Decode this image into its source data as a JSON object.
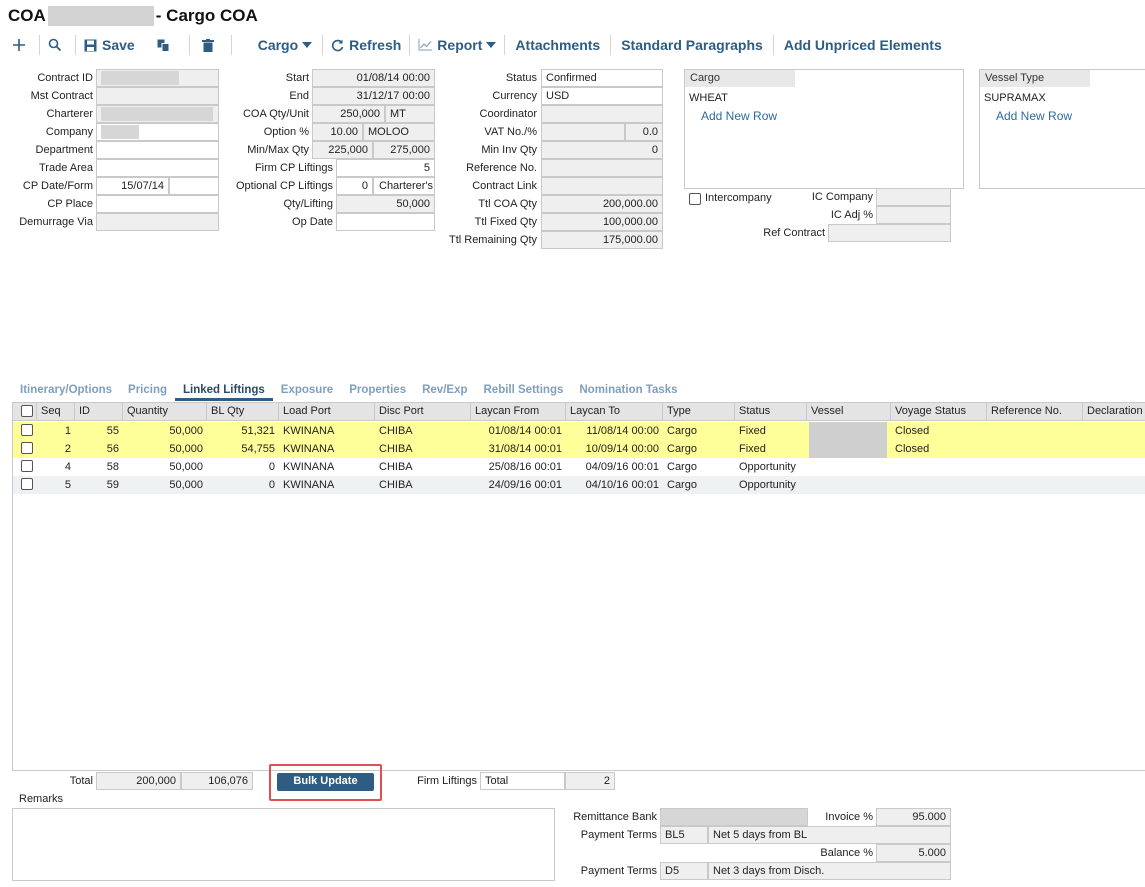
{
  "header": {
    "title_prefix": "COA",
    "title_suffix": "- Cargo COA"
  },
  "toolbar": {
    "save": "Save",
    "cargo": "Cargo",
    "refresh": "Refresh",
    "report": "Report",
    "attachments": "Attachments",
    "standard_paragraphs": "Standard Paragraphs",
    "add_unpriced": "Add Unpriced Elements"
  },
  "col1": {
    "contract_id": "Contract ID",
    "mst_contract": "Mst Contract",
    "charterer": "Charterer",
    "company": "Company",
    "department": "Department",
    "trade_area": "Trade Area",
    "cp_date_form": "CP Date/Form",
    "cp_date_value": "15/07/14",
    "cp_place": "CP Place",
    "demurrage_via": "Demurrage Via"
  },
  "col2": {
    "start": "Start",
    "start_value": "01/08/14 00:00",
    "end": "End",
    "end_value": "31/12/17 00:00",
    "coa_qty_unit": "COA Qty/Unit",
    "coa_qty_value": "250,000",
    "coa_unit_value": "MT",
    "option_pct": "Option %",
    "option_value": "10.00",
    "option_type": "MOLOO",
    "min_max_qty": "Min/Max Qty",
    "min_value": "225,000",
    "max_value": "275,000",
    "firm_cp_liftings": "Firm CP Liftings",
    "firm_cp_value": "5",
    "optional_cp_liftings": "Optional CP Liftings",
    "optional_cp_value": "0",
    "optional_cp_option": "Charterer's",
    "qty_lifting": "Qty/Lifting",
    "qty_lifting_value": "50,000",
    "op_date": "Op Date"
  },
  "col3": {
    "status": "Status",
    "status_value": "Confirmed",
    "currency": "Currency",
    "currency_value": "USD",
    "coordinator": "Coordinator",
    "vat": "VAT No./%",
    "vat_value": "0.0",
    "min_inv_qty": "Min Inv Qty",
    "min_inv_value": "0",
    "reference_no": "Reference No.",
    "contract_link": "Contract Link",
    "ttl_coa_qty": "Ttl COA Qty",
    "ttl_coa_value": "200,000.00",
    "ttl_fixed_qty": "Ttl Fixed Qty",
    "ttl_fixed_value": "100,000.00",
    "ttl_remaining_qty": "Ttl Remaining Qty",
    "ttl_remaining_value": "175,000.00"
  },
  "cargo_box": {
    "header": "Cargo",
    "item": "WHEAT",
    "add_row": "Add New Row"
  },
  "vessel_box": {
    "header": "Vessel Type",
    "item": "SUPRAMAX",
    "add_row": "Add New Row"
  },
  "ic": {
    "intercompany": "Intercompany",
    "ic_company": "IC Company",
    "ic_adj": "IC Adj %",
    "ref_contract": "Ref Contract"
  },
  "tabs": [
    "Itinerary/Options",
    "Pricing",
    "Linked Liftings",
    "Exposure",
    "Properties",
    "Rev/Exp",
    "Rebill Settings",
    "Nomination Tasks"
  ],
  "grid": {
    "columns": [
      "Seq",
      "ID",
      "Quantity",
      "BL Qty",
      "Load Port",
      "Disc Port",
      "Laycan From",
      "Laycan To",
      "Type",
      "Status",
      "Vessel",
      "Voyage Status",
      "Reference No.",
      "Declaration"
    ],
    "rows": [
      [
        "1",
        "55",
        "50,000",
        "51,321",
        "KWINANA",
        "CHIBA",
        "01/08/14 00:01",
        "11/08/14 00:00",
        "Cargo",
        "Fixed",
        "",
        "Closed",
        "",
        ""
      ],
      [
        "2",
        "56",
        "50,000",
        "54,755",
        "KWINANA",
        "CHIBA",
        "31/08/14 00:01",
        "10/09/14 00:00",
        "Cargo",
        "Fixed",
        "",
        "Closed",
        "",
        ""
      ],
      [
        "4",
        "58",
        "50,000",
        "0",
        "KWINANA",
        "CHIBA",
        "25/08/16 00:01",
        "04/09/16 00:01",
        "Cargo",
        "Opportunity",
        "",
        "",
        "",
        ""
      ],
      [
        "5",
        "59",
        "50,000",
        "0",
        "KWINANA",
        "CHIBA",
        "24/09/16 00:01",
        "04/10/16 00:01",
        "Cargo",
        "Opportunity",
        "",
        "",
        "",
        ""
      ]
    ],
    "highlight_color": "#ffff99"
  },
  "footer": {
    "total": "Total",
    "total_qty": "200,000",
    "total_bl": "106,076",
    "bulk_update": "Bulk Update",
    "firm_liftings": "Firm Liftings",
    "firm_total_label": "Total",
    "firm_total_value": "2",
    "remarks": "Remarks"
  },
  "payment": {
    "remittance_bank": "Remittance Bank",
    "invoice_pct": "Invoice %",
    "invoice_value": "95.000",
    "payment_terms_1": "Payment Terms",
    "pt1_code": "BL5",
    "pt1_desc": "Net 5 days from BL",
    "balance_pct": "Balance %",
    "balance_value": "5.000",
    "payment_terms_2": "Payment Terms",
    "pt2_code": "D5",
    "pt2_desc": "Net 3 days from Disch."
  },
  "colors": {
    "accent": "#2e5c82",
    "highlight_border": "#e05050"
  }
}
